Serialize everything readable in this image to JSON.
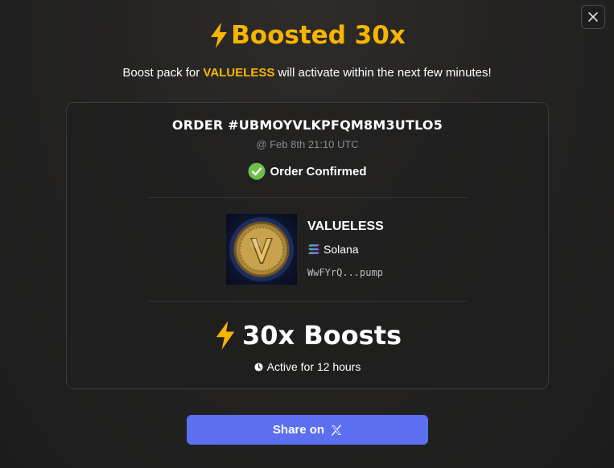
{
  "dialog": {
    "title": "Boosted 30x",
    "subtitle": {
      "prefix": "Boost pack for ",
      "token": "VALUELESS",
      "suffix": " will activate within the next few minutes!"
    }
  },
  "order": {
    "id": "ORDER #UBMOYVLKPFQM8M3UTLO5",
    "timestamp": "@ Feb 8th 21:10 UTC",
    "status": "Order Confirmed"
  },
  "token": {
    "name": "VALUELESS",
    "chain": "Solana",
    "address": "WwFYrQ...pump"
  },
  "boost": {
    "count": "30x Boosts",
    "duration": "Active for 12 hours"
  },
  "share": {
    "label": "Share on"
  },
  "colors": {
    "accent": "#f7b500",
    "confirm": "#6cc04a",
    "button": "#5b6ff0"
  },
  "icons": [
    "close-icon",
    "lightning-icon",
    "check-circle-icon",
    "solana-icon",
    "clock-icon",
    "x-logo-icon"
  ]
}
